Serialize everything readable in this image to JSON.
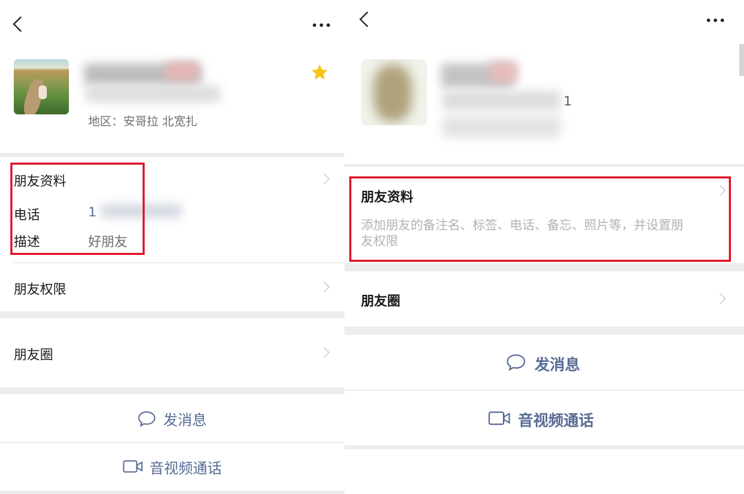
{
  "left_panel": {
    "region_text": "地区：安哥拉  北宽扎",
    "friend_info_title": "朋友资料",
    "phone_label": "电话",
    "phone_value": "1",
    "desc_label": "描述",
    "desc_value": "好朋友",
    "permissions": "朋友权限",
    "moments": "朋友圈",
    "send_message": "发消息",
    "av_call": "音视频通话"
  },
  "right_panel": {
    "visible_digit": "1",
    "friend_info_title": "朋友资料",
    "friend_info_desc_line1": "添加朋友的备注名、标签、电话、备忘、照片等，并设置朋",
    "friend_info_desc_line2": "友权限",
    "moments": "朋友圈",
    "send_message": "发消息",
    "av_call": "音视频通话"
  },
  "colors": {
    "highlight": "#e0162b",
    "action": "#576b95",
    "star": "#f7c316"
  },
  "icons": [
    "back-icon",
    "more-icon",
    "star-icon",
    "chevron-right-icon",
    "chat-bubble-icon",
    "video-camera-icon"
  ]
}
